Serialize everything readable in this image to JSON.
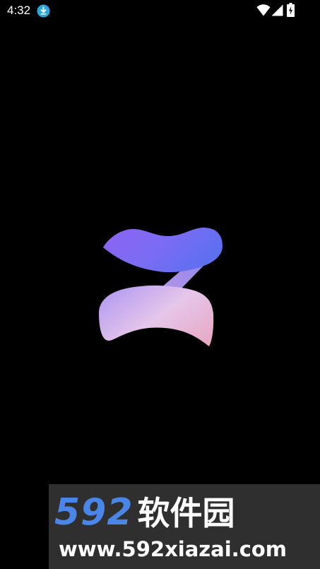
{
  "status_bar": {
    "time": "4:32",
    "download_icon": "download-arrow-icon",
    "wifi_icon": "wifi-icon",
    "signal_icon": "cellular-signal-icon",
    "battery_icon": "battery-charging-icon",
    "download_icon_color": "#29a7e1"
  },
  "splash": {
    "logo_icon": "app-z-logo-icon",
    "background_color": "#000000",
    "gradient_colors": [
      "#7b5cf5",
      "#6f6cf0",
      "#b9a2f0",
      "#e9b4cc"
    ]
  },
  "watermark": {
    "brand_number": "592",
    "brand_text": "软件园",
    "url": "www.592xiazai.com",
    "brand_color": "#4a86e8"
  }
}
